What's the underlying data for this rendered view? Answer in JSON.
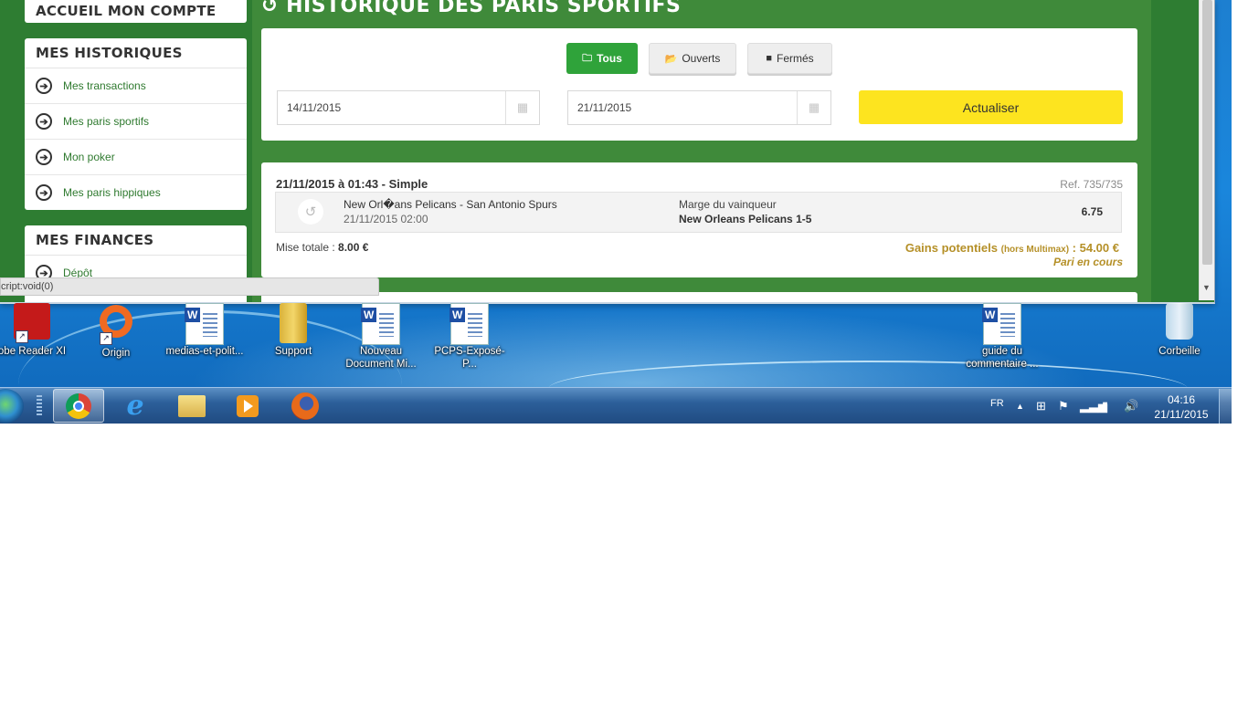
{
  "sidebar": {
    "account_title": "ACCUEIL MON COMPTE",
    "history_title": "MES HISTORIQUES",
    "history_items": [
      "Mes transactions",
      "Mes paris sportifs",
      "Mon poker",
      "Mes paris hippiques"
    ],
    "finance_title": "MES FINANCES",
    "finance_items": [
      "Dépôt"
    ]
  },
  "main": {
    "title": "HISTORIQUE DES PARIS SPORTIFS",
    "filters": {
      "all": "Tous",
      "open": "Ouverts",
      "closed": "Fermés"
    },
    "date_from": "14/11/2015",
    "date_to": "21/11/2015",
    "refresh": "Actualiser"
  },
  "bet": {
    "header": "21/11/2015 à 01:43 - Simple",
    "ref": "Ref. 735/735",
    "match": "New Orl�ans Pelicans - San Antonio Spurs",
    "match_date": "21/11/2015 02:00",
    "market": "Marge du vainqueur",
    "selection": "New Orleans Pelicans 1-5",
    "odds": "6.75",
    "stake_label": "Mise totale : ",
    "stake": "8.00 €",
    "gains_label": "Gains potentiels",
    "gains_note": "(hors Multimax)",
    "gains_value": " : 54.00 €",
    "status": "Pari en cours"
  },
  "status_bar": "cript:void(0)",
  "desktop_icons": [
    "obe Reader XI",
    "Origin",
    "medias-et-polit...",
    "Support",
    "Nouveau Document Mi...",
    "PCPS-Exposé-P...",
    "guide du commentaire ...",
    "Corbeille"
  ],
  "taskbar": {
    "lang": "FR",
    "time": "04:16",
    "date": "21/11/2015"
  },
  "colors": {
    "brand_green": "#2e7d32",
    "accent_yellow": "#fde41f",
    "gold": "#b59028",
    "button_green": "#2fa33a"
  }
}
